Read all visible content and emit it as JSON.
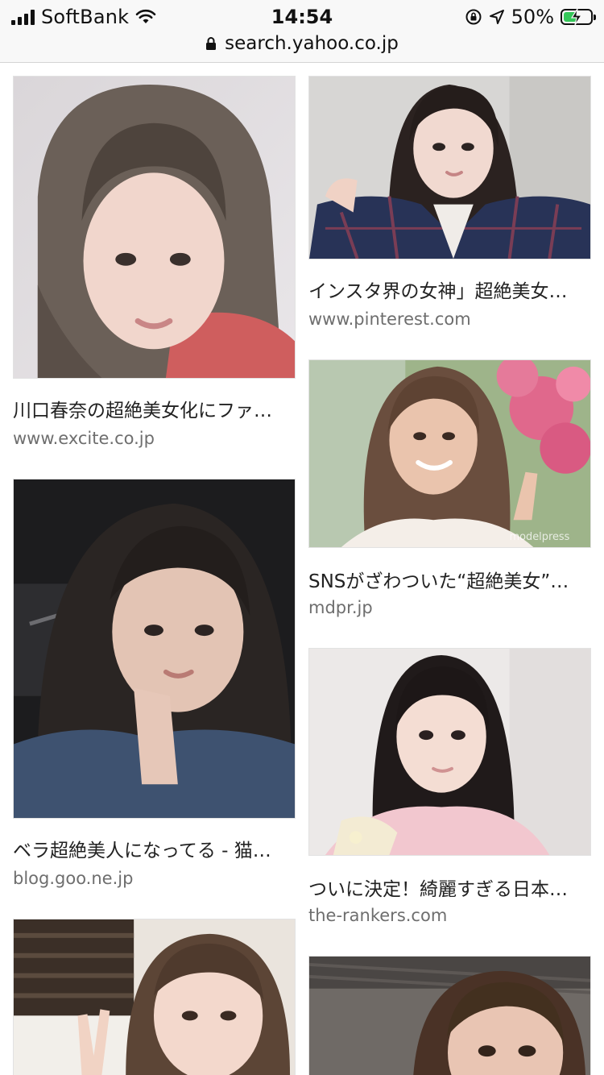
{
  "status_bar": {
    "carrier": "SoftBank",
    "time": "14:54",
    "battery_percent": "50%",
    "battery_level": 0.5,
    "icons": [
      "signal-icon",
      "wifi-icon",
      "orientation-lock-icon",
      "location-icon",
      "battery-charging-icon"
    ]
  },
  "browser": {
    "url": "search.yahoo.co.jp",
    "lock_icon": "lock-icon"
  },
  "results": [
    {
      "title": "川口春奈の超絶美女化にファ…",
      "source": "www.excite.co.jp"
    },
    {
      "title": "ベラ超絶美人になってる - 猫…",
      "source": "blog.goo.ne.jp"
    },
    {
      "title": "",
      "source": ""
    },
    {
      "title": "インスタ界の女神」超絶美女…",
      "source": "www.pinterest.com"
    },
    {
      "title": "SNSがざわついた“超絶美女”…",
      "source": "mdpr.jp"
    },
    {
      "title": "ついに決定！綺麗すぎる日本…",
      "source": "the-rankers.com"
    },
    {
      "title": "",
      "source": ""
    }
  ],
  "watermarks": {
    "mdpr": "modelpress"
  },
  "colors": {
    "status_bar_bg": "#f8f8f8",
    "battery_fill": "#34c759",
    "title_text": "#222222",
    "source_text": "#6e6e6e"
  }
}
